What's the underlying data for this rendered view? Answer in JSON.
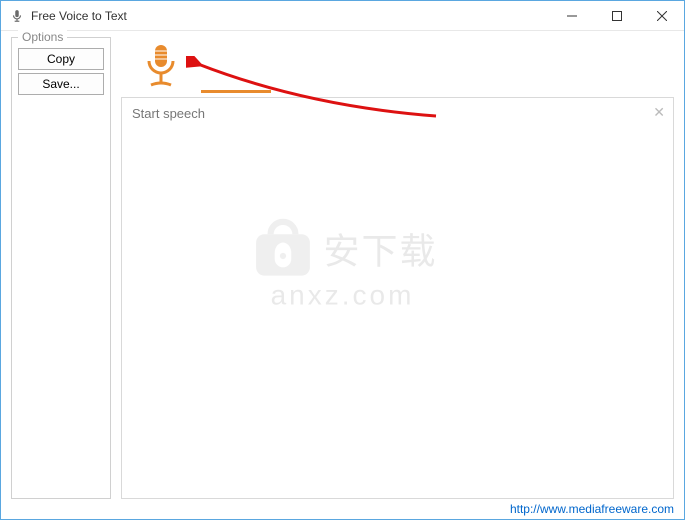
{
  "window": {
    "title": "Free Voice to Text"
  },
  "options": {
    "legend": "Options",
    "copy_label": "Copy",
    "save_label": "Save..."
  },
  "textarea": {
    "placeholder": "Start speech"
  },
  "footer": {
    "link_text": "http://www.mediafreeware.com"
  },
  "watermark": {
    "cn": "安下载",
    "en": "anxz.com"
  },
  "colors": {
    "accent_orange": "#e88b2d",
    "link_blue": "#0066cc"
  }
}
